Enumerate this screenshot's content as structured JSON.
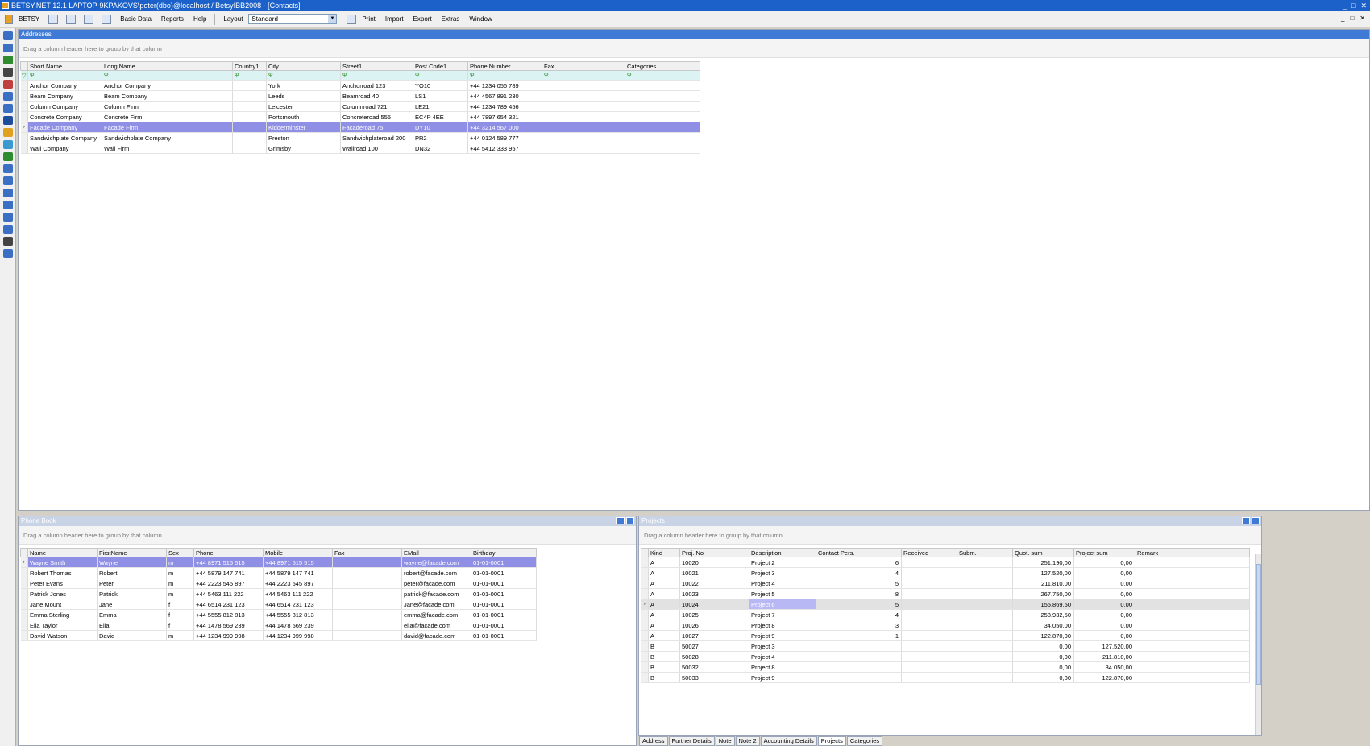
{
  "window": {
    "title": "BETSY.NET 12.1  LAPTOP-9KPAKOVS\\peter(dbo)@localhost / BetsyIBB2008 - [Contacts]",
    "controls": [
      "_",
      "□",
      "✕"
    ]
  },
  "menu": {
    "items": [
      "BETSY",
      "Basic Data",
      "Reports",
      "Help",
      "Layout"
    ],
    "layout_value": "Standard",
    "print": "Print",
    "import": "Import",
    "export": "Export",
    "extras": "Extras",
    "window": "Window"
  },
  "sidebar": {
    "icons": [
      "#3a6fc4",
      "#3a6fc4",
      "#2e8b2e",
      "#444",
      "#c04040",
      "#3a6fc4",
      "#3a6fc4",
      "#1f4d9e",
      "#e0a020",
      "#3a9ad0",
      "#2e8b2e",
      "#3a6fc4",
      "#3a6fc4",
      "#3a6fc4",
      "#3a6fc4",
      "#3a6fc4",
      "#3a6fc4",
      "#444",
      "#3a6fc4"
    ]
  },
  "addresses": {
    "title": "Addresses",
    "group_hint": "Drag a column header here to group by that column",
    "columns": [
      "Short Name",
      "Long Name",
      "Country1",
      "City",
      "Street1",
      "Post Code1",
      "Phone Number",
      "Fax",
      "Categories"
    ],
    "filter_mark": "Φ",
    "rows": [
      [
        "Anchor Company",
        "Anchor Company",
        "",
        "York",
        "Anchorroad 123",
        "YO10",
        "+44 1234 056 789",
        "",
        ""
      ],
      [
        "Beam Company",
        "Beam Company",
        "",
        "Leeds",
        "Beamroad 40",
        "LS1",
        "+44 4567 891 230",
        "",
        ""
      ],
      [
        "Column Company",
        "Column Firm",
        "",
        "Leicester",
        "Columnroad 721",
        "LE21",
        "+44 1234 789 456",
        "",
        ""
      ],
      [
        "Concrete Company",
        "Concrete Firm",
        "",
        "Portsmouth",
        "Concreteroad 555",
        "EC4P 4EE",
        "+44 7897 654 321",
        "",
        ""
      ],
      [
        "Facade Company",
        "Facade Firm",
        "",
        "Kidderminster",
        "Facaderoad 75",
        "DY10",
        "+44 3214 567 000",
        "",
        ""
      ],
      [
        "Sandwichplate Company",
        "Sandwichplate Company",
        "",
        "Preston",
        "Sandwichplateroad 200",
        "PR2",
        "+44 0124 589 777",
        "",
        ""
      ],
      [
        "Wall Company",
        "Wall Firm",
        "",
        "Grimsby",
        "Wallroad 100",
        "DN32",
        "+44 5412 333 957",
        "",
        ""
      ]
    ]
  },
  "phonebook": {
    "title": "Phone Book",
    "group_hint": "Drag a column header here to group by that column",
    "columns": [
      "Name",
      "FirstName",
      "Sex",
      "Phone",
      "Mobile",
      "Fax",
      "EMail",
      "Birthday"
    ],
    "rows": [
      [
        "Wayne Smith",
        "Wayne",
        "m",
        "+44 8971 515 515",
        "+44 8971 515 515",
        "",
        "wayne@facade.com",
        "01-01-0001"
      ],
      [
        "Robert Thomas",
        "Robert",
        "m",
        "+44 5879 147 741",
        "+44 5879 147 741",
        "",
        "robert@facade.com",
        "01-01-0001"
      ],
      [
        "Peter Evans",
        "Peter",
        "m",
        "+44 2223 545 897",
        "+44 2223 545 897",
        "",
        "peter@facade.com",
        "01-01-0001"
      ],
      [
        "Patrick Jones",
        "Patrick",
        "m",
        "+44 5463 111 222",
        "+44 5463 111 222",
        "",
        "patrick@facade.com",
        "01-01-0001"
      ],
      [
        "Jane Mount",
        "Jane",
        "f",
        "+44 6514 231 123",
        "+44 6514 231 123",
        "",
        "Jane@facade.com",
        "01-01-0001"
      ],
      [
        "Emma Sterling",
        "Emma",
        "f",
        "+44 5555 812 813",
        "+44 5555 812 813",
        "",
        "emma@facade.com",
        "01-01-0001"
      ],
      [
        "Ella Taylor",
        "Ella",
        "f",
        "+44 1478 569 239",
        "+44 1478 569 239",
        "",
        "ella@facade.com",
        "01-01-0001"
      ],
      [
        "David Watson",
        "David",
        "m",
        "+44 1234 999 998",
        "+44 1234 999 998",
        "",
        "david@facade.com",
        "01-01-0001"
      ]
    ]
  },
  "projects": {
    "title": "Projects",
    "group_hint": "Drag a column header here to group by that column",
    "columns": [
      "Kind",
      "Proj. No",
      "Description",
      "Contact Pers.",
      "Received",
      "Subm.",
      "Quot. sum",
      "Project sum",
      "Remark"
    ],
    "rows": [
      [
        "A",
        "10020",
        "Project 2",
        "6",
        "",
        "",
        "251.190,00",
        "0,00",
        ""
      ],
      [
        "A",
        "10021",
        "Project 3",
        "4",
        "",
        "",
        "127.520,00",
        "0,00",
        ""
      ],
      [
        "A",
        "10022",
        "Project 4",
        "5",
        "",
        "",
        "211.810,00",
        "0,00",
        ""
      ],
      [
        "A",
        "10023",
        "Project 5",
        "8",
        "",
        "",
        "267.750,00",
        "0,00",
        ""
      ],
      [
        "A",
        "10024",
        "Project 6",
        "5",
        "",
        "",
        "155.869,50",
        "0,00",
        ""
      ],
      [
        "A",
        "10025",
        "Project 7",
        "4",
        "",
        "",
        "258.932,50",
        "0,00",
        ""
      ],
      [
        "A",
        "10026",
        "Project 8",
        "3",
        "",
        "",
        "34.050,00",
        "0,00",
        ""
      ],
      [
        "A",
        "10027",
        "Project 9",
        "1",
        "",
        "",
        "122.870,00",
        "0,00",
        ""
      ],
      [
        "B",
        "50027",
        "Project 3",
        "",
        "",
        "",
        "0,00",
        "127.520,00",
        ""
      ],
      [
        "B",
        "50028",
        "Project 4",
        "",
        "",
        "",
        "0,00",
        "211.810,00",
        ""
      ],
      [
        "B",
        "50032",
        "Project 8",
        "",
        "",
        "",
        "0,00",
        "34.050,00",
        ""
      ],
      [
        "B",
        "50033",
        "Project 9",
        "",
        "",
        "",
        "0,00",
        "122.870,00",
        ""
      ]
    ]
  },
  "tabs": [
    "Address",
    "Further Details",
    "Note",
    "Note 2",
    "Accounting Details",
    "Projects",
    "Categories"
  ]
}
